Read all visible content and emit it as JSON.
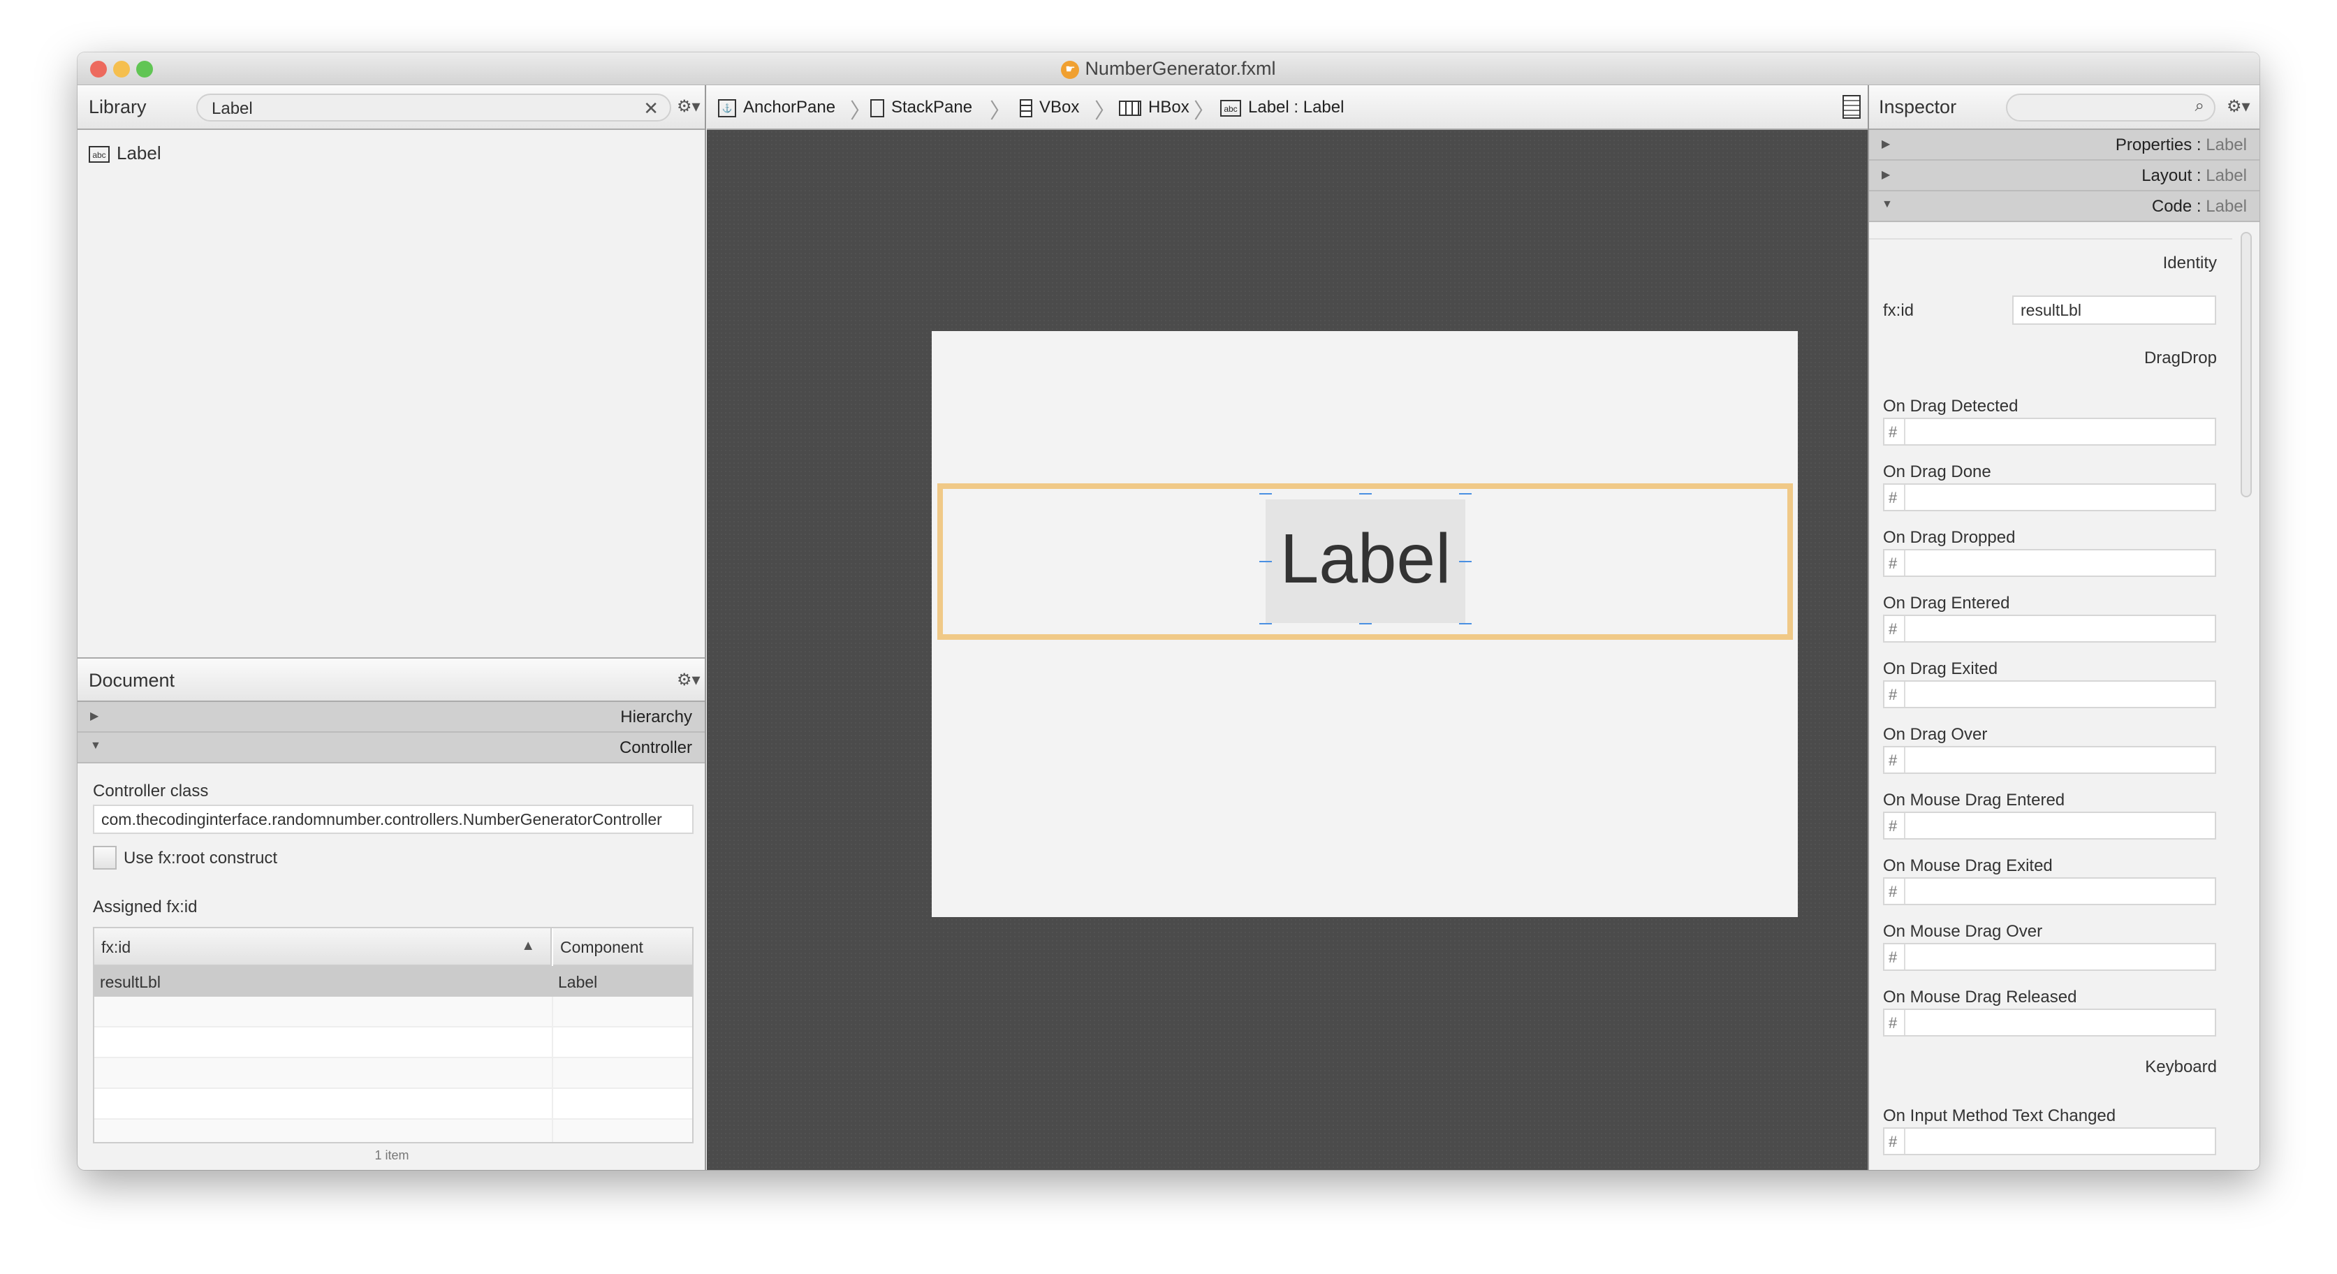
{
  "window": {
    "title": "NumberGenerator.fxml",
    "traffic_lights": {
      "close": "#ed6a5e",
      "minimize": "#f5bf4f",
      "zoom": "#61c554"
    }
  },
  "library": {
    "title": "Library",
    "search_value": "Label",
    "clear_icon": "close-icon",
    "items": [
      {
        "icon": "label-icon",
        "label": "Label"
      }
    ]
  },
  "breadcrumb": [
    {
      "icon": "anchorpane-icon",
      "label": "AnchorPane"
    },
    {
      "icon": "stackpane-icon",
      "label": "StackPane"
    },
    {
      "icon": "vbox-icon",
      "label": "VBox"
    },
    {
      "icon": "hbox-icon",
      "label": "HBox"
    },
    {
      "icon": "label-icon",
      "label": "Label : Label"
    }
  ],
  "canvas": {
    "label_text": "Label",
    "selection_color": "#f0c987"
  },
  "document": {
    "title": "Document",
    "sections": [
      {
        "label": "Hierarchy",
        "expanded": false
      },
      {
        "label": "Controller",
        "expanded": true
      }
    ],
    "controller_class_label": "Controller class",
    "controller_class_value": "com.thecodinginterface.randomnumber.controllers.NumberGeneratorController",
    "fx_root_label": "Use fx:root construct",
    "fx_root_checked": false,
    "assigned_label": "Assigned fx:id",
    "table": {
      "columns": [
        "fx:id",
        "Component"
      ],
      "sort_indicator": "▲",
      "rows": [
        [
          "resultLbl",
          "Label"
        ]
      ],
      "footer": "1 item"
    }
  },
  "inspector": {
    "title": "Inspector",
    "search_placeholder": "",
    "sections": [
      {
        "name": "Properties",
        "target": "Label",
        "expanded": false
      },
      {
        "name": "Layout",
        "target": "Label",
        "expanded": false
      },
      {
        "name": "Code",
        "target": "Label",
        "expanded": true
      }
    ],
    "identity": {
      "heading": "Identity",
      "fxid_label": "fx:id",
      "fxid_value": "resultLbl"
    },
    "dragdrop": {
      "heading": "DragDrop",
      "events": [
        "On Drag Detected",
        "On Drag Done",
        "On Drag Dropped",
        "On Drag Entered",
        "On Drag Exited",
        "On Drag Over",
        "On Mouse Drag Entered",
        "On Mouse Drag Exited",
        "On Mouse Drag Over",
        "On Mouse Drag Released"
      ]
    },
    "keyboard": {
      "heading": "Keyboard",
      "events": [
        "On Input Method Text Changed"
      ]
    },
    "hash": "#"
  }
}
